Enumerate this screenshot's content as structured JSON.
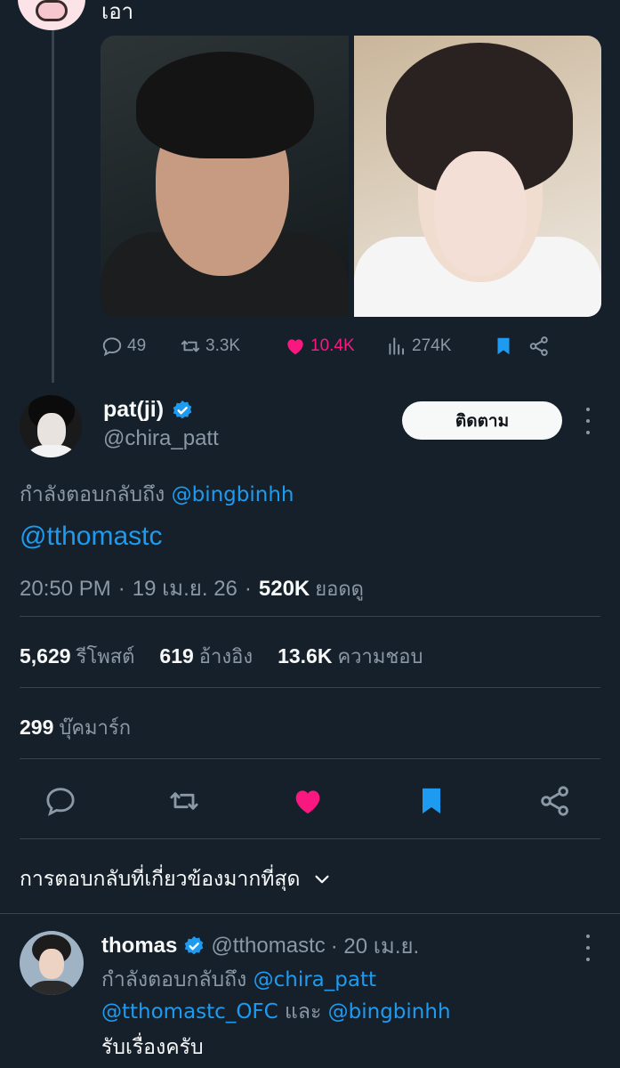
{
  "parent_tweet": {
    "text": "เอา",
    "replies": "49",
    "reposts": "3.3K",
    "likes": "10.4K",
    "views": "274K"
  },
  "main_tweet": {
    "display_name": "pat(ji)",
    "handle": "@chira_patt",
    "follow_label": "ติดตาม",
    "replying_prefix": "กำลังตอบกลับถึง",
    "replying_to": "@bingbinhh",
    "text": "@tthomastc",
    "time": "20:50 PM",
    "date": "19 เม.ย. 26",
    "views_count": "520K",
    "views_label": "ยอดดู",
    "stats": {
      "reposts_num": "5,629",
      "reposts_label": "รีโพสต์",
      "quotes_num": "619",
      "quotes_label": "อ้างอิง",
      "likes_num": "13.6K",
      "likes_label": "ความชอบ",
      "bookmarks_num": "299",
      "bookmarks_label": "บุ๊คมาร์ก"
    }
  },
  "replies_sort": {
    "label": "การตอบกลับที่เกี่ยวข้องมากที่สุด"
  },
  "reply": {
    "display_name": "thomas",
    "handle": "@tthomastc",
    "date": "· 20 เม.ย.",
    "replying_prefix": "กำลังตอบกลับถึง",
    "replying_to_1": "@chira_patt",
    "replying_to_2": "@tthomastc_OFC",
    "and_word": "และ",
    "replying_to_3": "@bingbinhh",
    "text": "รับเรื่องครับ"
  },
  "colors": {
    "background": "#15202b",
    "accent_blue": "#1d9bf0",
    "like_pink": "#f91880",
    "muted": "#8b98a5",
    "divider": "#38444d"
  },
  "icons": [
    "reply-icon",
    "repost-icon",
    "heart-icon",
    "views-icon",
    "bookmark-icon",
    "share-icon",
    "verified-icon",
    "more-icon",
    "chevron-down-icon"
  ]
}
